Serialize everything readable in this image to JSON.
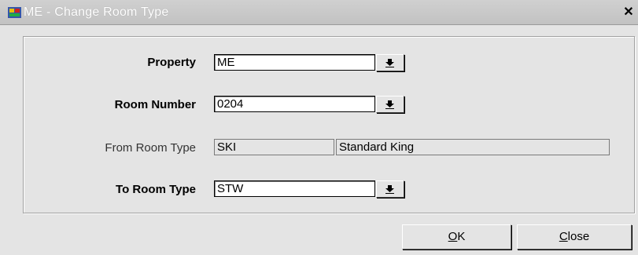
{
  "window": {
    "title": "ME - Change Room Type",
    "close_glyph": "✕"
  },
  "form": {
    "property": {
      "label": "Property",
      "value": "ME"
    },
    "room_number": {
      "label": "Room Number",
      "value": "0204"
    },
    "from_room_type": {
      "label": "From Room Type",
      "code": "SKI",
      "description": "Standard King"
    },
    "to_room_type": {
      "label": "To Room Type",
      "value": "STW"
    }
  },
  "buttons": {
    "ok": {
      "mnemonic": "O",
      "rest": "K"
    },
    "close": {
      "mnemonic": "C",
      "rest": "lose"
    }
  },
  "icons": {
    "app": "app-icon",
    "dropdown": "dropdown-arrow-icon",
    "close": "close-icon"
  }
}
